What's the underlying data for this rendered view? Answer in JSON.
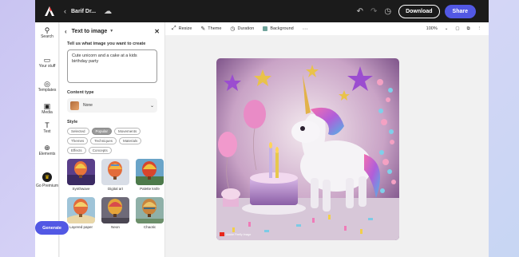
{
  "topbar": {
    "doc_title": "Barif Dr...",
    "download_label": "Download",
    "share_label": "Share"
  },
  "rail": {
    "items": [
      {
        "label": "Search",
        "icon": "search-icon"
      },
      {
        "label": "Your stuff",
        "icon": "folder-icon"
      },
      {
        "label": "Templates",
        "icon": "templates-icon"
      },
      {
        "label": "Media",
        "icon": "media-icon"
      },
      {
        "label": "Text",
        "icon": "text-icon"
      },
      {
        "label": "Elements",
        "icon": "elements-icon"
      },
      {
        "label": "Go Premium",
        "icon": "crown-icon"
      }
    ]
  },
  "panel": {
    "title": "Text to image",
    "prompt_label": "Tell us what image you want to create",
    "prompt_value": "Cute unicorn and a cake at a kids birthday party",
    "content_type_label": "Content type",
    "content_type_value": "None",
    "style_label": "Style",
    "chips": [
      "Selected",
      "Popular",
      "Movements",
      "Themes",
      "Techniques",
      "Materials",
      "Effects",
      "Concepts"
    ],
    "active_chip": "Popular",
    "styles": [
      {
        "label": "Synthwave"
      },
      {
        "label": "Digital art"
      },
      {
        "label": "Palette knife"
      },
      {
        "label": "Layered paper"
      },
      {
        "label": "Neon"
      },
      {
        "label": "Chaotic"
      }
    ],
    "generate_label": "Generate"
  },
  "toolbar": {
    "items": [
      "Resize",
      "Theme",
      "Duration",
      "Background"
    ],
    "zoom": "100%"
  },
  "canvas": {
    "badge_text": "Adobe Firefly Image"
  },
  "colors": {
    "accent": "#5258e4",
    "topbar": "#1b1b1b"
  }
}
